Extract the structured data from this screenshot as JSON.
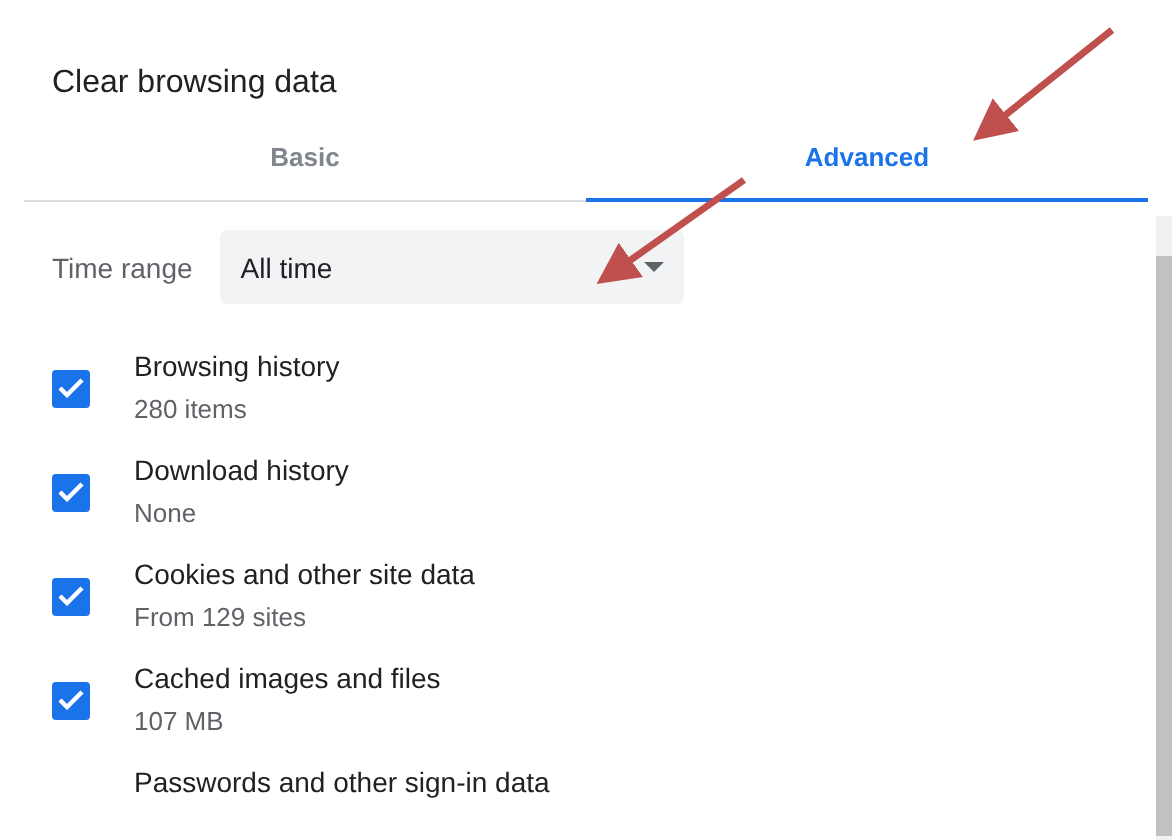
{
  "dialog": {
    "title": "Clear browsing data"
  },
  "tabs": [
    {
      "label": "Basic",
      "selected": false
    },
    {
      "label": "Advanced",
      "selected": true
    }
  ],
  "time_range": {
    "label": "Time range",
    "value": "All time"
  },
  "items": [
    {
      "title": "Browsing history",
      "detail": "280 items",
      "checked": true
    },
    {
      "title": "Download history",
      "detail": "None",
      "checked": true
    },
    {
      "title": "Cookies and other site data",
      "detail": "From 129 sites",
      "checked": true
    },
    {
      "title": "Cached images and files",
      "detail": "107 MB",
      "checked": true
    },
    {
      "title": "Passwords and other sign-in data"
    }
  ]
}
